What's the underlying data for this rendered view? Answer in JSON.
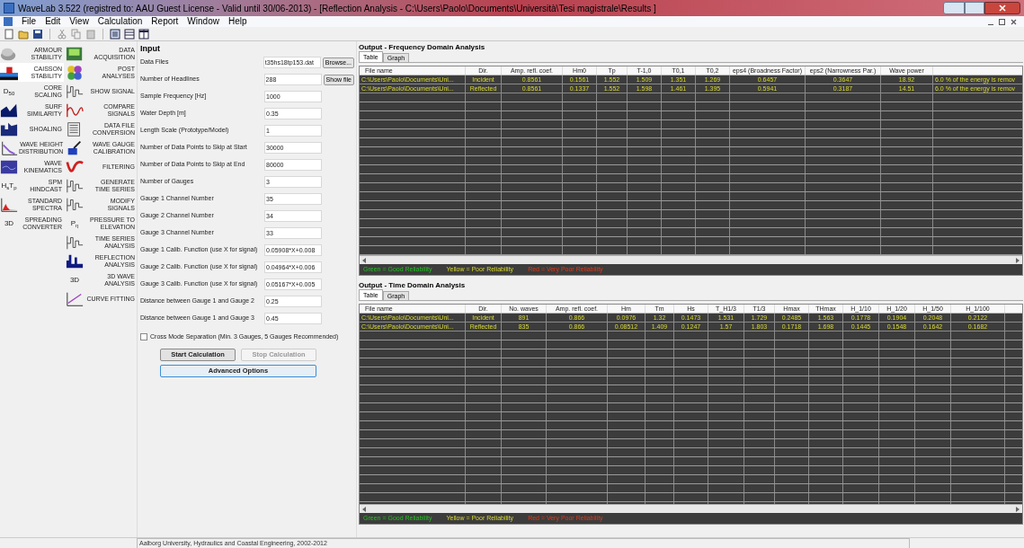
{
  "window": {
    "title": "WaveLab 3.522 (registred to: AAU Guest License - Valid until 30/06-2013) - [Reflection Analysis - C:\\Users\\Paolo\\Documents\\Università\\Tesi magistrale\\Results ]"
  },
  "menu": [
    "File",
    "Edit",
    "View",
    "Calculation",
    "Report",
    "Window",
    "Help"
  ],
  "sidebar": {
    "columns": [
      [
        {
          "label": "ARMOUR STABILITY",
          "selected": false
        },
        {
          "label": "CAISSON STABILITY",
          "selected": true
        },
        {
          "label": "CORE SCALING",
          "selected": false,
          "icon_text": "D$_{50}$"
        },
        {
          "label": "SURF SIMILARITY",
          "selected": false
        },
        {
          "label": "SHOALING",
          "selected": false
        },
        {
          "label": "WAVE HEIGHT DISTRIBUTION",
          "selected": false
        },
        {
          "label": "WAVE KINEMATICS",
          "selected": false
        },
        {
          "label": "SPM HINDCAST",
          "selected": false,
          "icon_text": "H$_{s}$T$_{p}$"
        },
        {
          "label": "STANDARD SPECTRA",
          "selected": false
        },
        {
          "label": "SPREADING CONVERTER",
          "selected": false,
          "icon_text": "3D"
        }
      ],
      [
        {
          "label": "DATA ACQUISITION",
          "selected": false
        },
        {
          "label": "POST ANALYSES",
          "selected": false
        },
        {
          "label": "SHOW SIGNAL",
          "selected": false
        },
        {
          "label": "COMPARE SIGNALS",
          "selected": false
        },
        {
          "label": "DATA FILE CONVERSION",
          "selected": false
        },
        {
          "label": "WAVE GAUGE CALIBRATION",
          "selected": false
        },
        {
          "label": "FILTERING",
          "selected": false
        },
        {
          "label": "GENERATE TIME SERIES",
          "selected": false
        },
        {
          "label": "MODIFY SIGNALS",
          "selected": false
        },
        {
          "label": "PRESSURE TO ELEVATION",
          "selected": false,
          "icon_text": "P$_{η}$"
        },
        {
          "label": "TIME SERIES ANALYSIS",
          "selected": false
        },
        {
          "label": "REFLECTION ANALYSIS",
          "selected": false
        },
        {
          "label": "3D WAVE ANALYSIS",
          "selected": false,
          "icon_text": "3D"
        },
        {
          "label": "CURVE FITTING",
          "selected": false
        }
      ]
    ]
  },
  "input": {
    "title": "Input",
    "fields": [
      {
        "label": "Data Files",
        "value": "t35hs18tp153.dat",
        "button": "Browse..."
      },
      {
        "label": "Number of Headlines",
        "value": "288",
        "button": "Show file"
      },
      {
        "label": "Sample Frequency [Hz]",
        "value": "1000"
      },
      {
        "label": "Water Depth [m]",
        "value": "0.35"
      },
      {
        "label": "Length Scale (Prototype/Model)",
        "value": "1"
      },
      {
        "label": "Number of Data Points to Skip at Start",
        "value": "30000"
      },
      {
        "label": "Number of Data Points to Skip at End",
        "value": "80000"
      },
      {
        "label": "Number of Gauges",
        "value": "3"
      },
      {
        "label": "Gauge 1 Channel Number",
        "value": "35"
      },
      {
        "label": "Gauge 2 Channel Number",
        "value": "34"
      },
      {
        "label": "Gauge 3 Channel Number",
        "value": "33"
      },
      {
        "label": "Gauge 1 Calib. Function (use X for signal)",
        "value": "0.05908*X+0.008"
      },
      {
        "label": "Gauge 2 Calib. Function (use X for signal)",
        "value": "0.04964*X+0.006"
      },
      {
        "label": "Gauge 3 Calib. Function (use X for signal)",
        "value": "0.05167*X+0.005"
      },
      {
        "label": "Distance between Gauge 1 and Gauge 2",
        "value": "0.25"
      },
      {
        "label": "Distance between Gauge 1 and Gauge 3",
        "value": "0.45"
      }
    ],
    "checkbox": {
      "label": "Cross Mode Separation (Min. 3 Gauges, 5 Gauges Recommended)",
      "checked": false
    },
    "buttons": [
      {
        "label": "Start Calculation",
        "disabled": false
      },
      {
        "label": "Stop Calculation",
        "disabled": true
      }
    ],
    "advanced_button": "Advanced Options"
  },
  "outputs": [
    {
      "title": "Output - Frequency Domain Analysis",
      "tabs": [
        {
          "label": "Table",
          "selected": true
        },
        {
          "label": "Graph",
          "selected": false
        }
      ],
      "columns": [
        "File name",
        "Dir.",
        "Amp. refl. coef.",
        "Hm0",
        "Tp",
        "T-1,0",
        "T0,1",
        "T0,2",
        "eps4 (Broadness Factor)",
        "eps2 (Narrowness Par.)",
        "Wave power",
        ""
      ],
      "rows": [
        [
          "C:\\Users\\Paolo\\Documents\\Uni...",
          "Incident",
          "0.8561",
          "0.1561",
          "1.552",
          "1.509",
          "1.351",
          "1.269",
          "0.6457",
          "0.3647",
          "18.92",
          "6.0 % of the energy is remov"
        ],
        [
          "C:\\Users\\Paolo\\Documents\\Uni...",
          "Reflected",
          "0.8561",
          "0.1337",
          "1.552",
          "1.598",
          "1.461",
          "1.395",
          "0.5941",
          "0.3187",
          "14.51",
          "6.0 % of the energy is remov"
        ]
      ],
      "legend": [
        {
          "label": "Green = Good Reliability",
          "kind": "good"
        },
        {
          "label": "Yellow = Poor Reliability",
          "kind": "poor"
        },
        {
          "label": "Red = Very Poor Reliability",
          "kind": "very_poor"
        }
      ]
    },
    {
      "title": "Output - Time Domain Analysis",
      "tabs": [
        {
          "label": "Table",
          "selected": true
        },
        {
          "label": "Graph",
          "selected": false
        }
      ],
      "columns": [
        "File name",
        "Dir.",
        "No. waves",
        "Amp. refl. coef.",
        "Hm",
        "Tm",
        "Hs",
        "T_H1/3",
        "T1/3",
        "Hmax",
        "THmax",
        "H_1/10",
        "H_1/20",
        "H_1/50",
        "H_1/100"
      ],
      "rows": [
        [
          "C:\\Users\\Paolo\\Documents\\Uni...",
          "Incident",
          "891",
          "0.866",
          "0.0976",
          "1.32",
          "0.1473",
          "1.531",
          "1.729",
          "0.2485",
          "1.563",
          "0.1778",
          "0.1904",
          "0.2048",
          "0.2122"
        ],
        [
          "C:\\Users\\Paolo\\Documents\\Uni...",
          "Reflected",
          "835",
          "0.866",
          "0.08512",
          "1.409",
          "0.1247",
          "1.57",
          "1.803",
          "0.1718",
          "1.698",
          "0.1445",
          "0.1548",
          "0.1642",
          "0.1682"
        ]
      ],
      "legend": [
        {
          "label": "Green = Good Reliability",
          "kind": "good"
        },
        {
          "label": "Yellow = Poor Reliability",
          "kind": "poor"
        },
        {
          "label": "Red = Very Poor Reliability",
          "kind": "very_poor"
        }
      ]
    }
  ],
  "status_bar": "Aalborg University, Hydraulics and Coastal Engineering, 2002-2012"
}
